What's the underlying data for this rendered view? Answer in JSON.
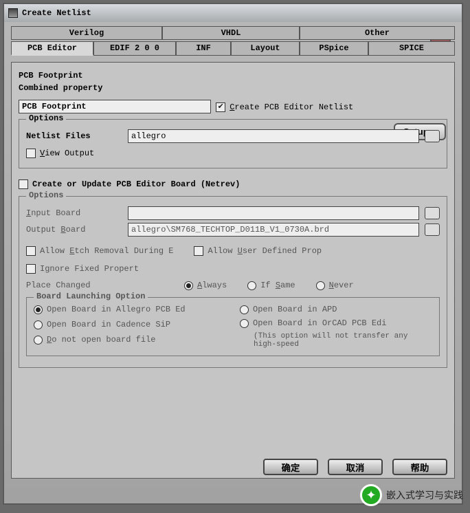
{
  "title": "Create Netlist",
  "tabs_top": [
    "Verilog",
    "VHDL",
    "Other"
  ],
  "tabs_bot": [
    "PCB Editor",
    "EDIF 2 0 0",
    "INF",
    "Layout",
    "PSpice",
    "SPICE"
  ],
  "footprint": {
    "heading": "PCB Footprint",
    "combined_label": "Combined property",
    "value": "PCB Footprint"
  },
  "create_netlist_label": "Create PCB Editor Netlist",
  "setup_label": "Setup...",
  "options_label": "Options",
  "netlist_files_label": "Netlist Files",
  "netlist_files_value": "allegro",
  "view_output_label": "View Output",
  "create_update_label": "Create or Update PCB Editor Board (Netrev)",
  "input_board_label": "Input Board",
  "input_board_value": "",
  "output_board_label": "Output Board",
  "output_board_value": "allegro\\SM768_TECHTOP_D011B_V1_0730A.brd",
  "allow_etch_label": "Allow Etch Removal During E",
  "allow_user_label": "Allow User Defined Prop",
  "ignore_fixed_label": "Ignore Fixed Propert",
  "place_changed_label": "Place Changed",
  "place_opts": [
    "Always",
    "If Same",
    "Never"
  ],
  "launch": {
    "legend": "Board Launching Option",
    "allegro": "Open Board in Allegro PCB Ed",
    "cadence": "Open Board in Cadence SiP",
    "donot": "Do not open board file",
    "apd": "Open Board in APD",
    "orcad": "Open Board in OrCAD PCB Edi",
    "orcad_note": "(This option will not transfer any high-speed"
  },
  "buttons": {
    "ok": "确定",
    "cancel": "取消",
    "help": "帮助"
  },
  "watermark": "嵌入式学习与实践"
}
